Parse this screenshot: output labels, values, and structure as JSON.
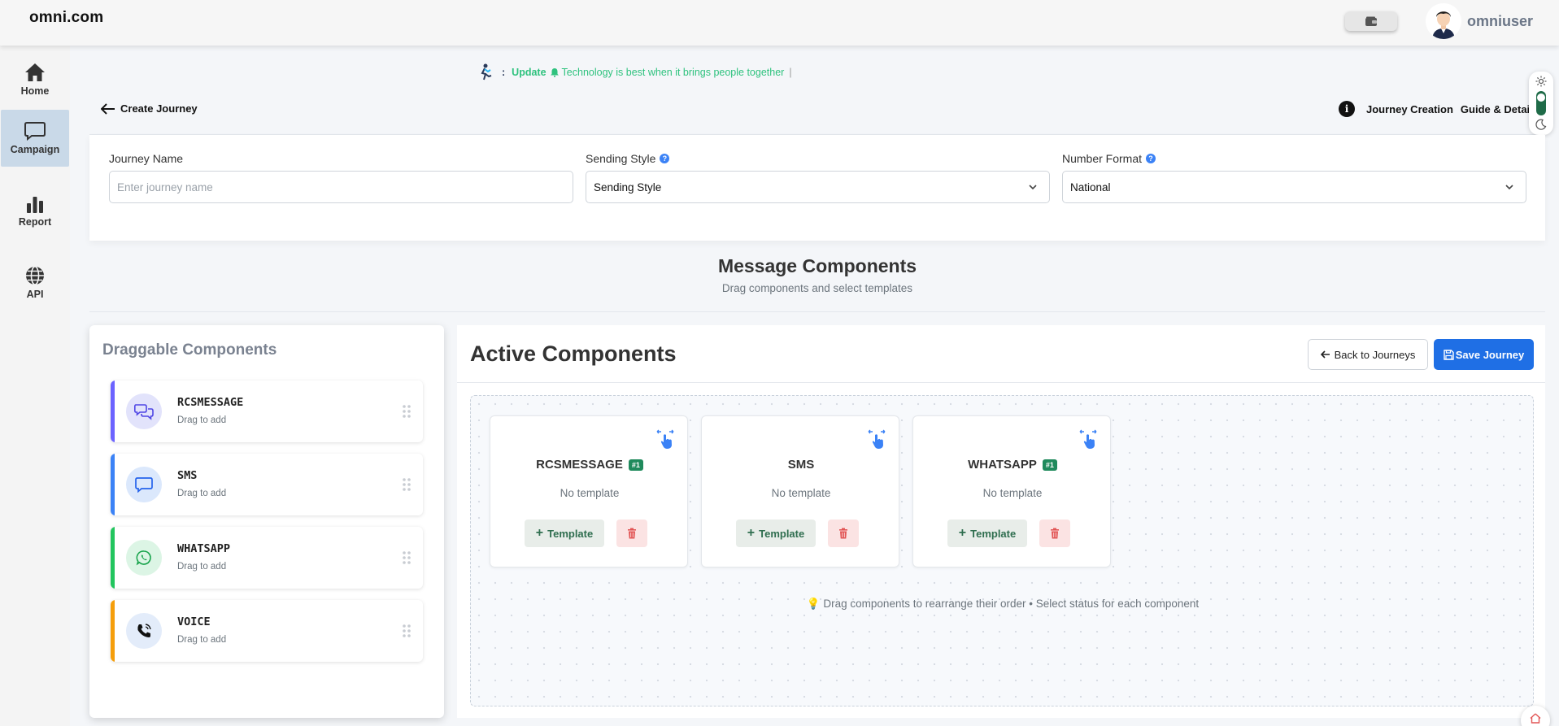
{
  "header": {
    "brand": "omni.com",
    "username": "omniuser"
  },
  "sidebar": {
    "items": [
      {
        "label": "Home",
        "icon": "home-icon"
      },
      {
        "label": "Campaign",
        "icon": "chat-icon",
        "active": true
      },
      {
        "label": "Report",
        "icon": "bar-chart-icon"
      },
      {
        "label": "API",
        "icon": "globe-icon"
      }
    ]
  },
  "marquee": {
    "prefix": ":",
    "update_label": "Update",
    "text": "Technology is best when it brings people together",
    "cursor": "|"
  },
  "page": {
    "back_label": "Create Journey",
    "guide_label_1": "Journey Creation",
    "guide_label_2": "Guide & Details"
  },
  "form": {
    "journey_name_label": "Journey Name",
    "journey_name_placeholder": "Enter journey name",
    "sending_style_label": "Sending Style",
    "sending_style_value": "Sending Style",
    "number_format_label": "Number Format",
    "number_format_value": "National"
  },
  "message_components": {
    "title": "Message Components",
    "subtitle": "Drag components and select templates"
  },
  "draggable": {
    "title": "Draggable Components",
    "items": [
      {
        "name": "RCSMESSAGE",
        "sub": "Drag to add",
        "color": "#6c63ff"
      },
      {
        "name": "SMS",
        "sub": "Drag to add",
        "color": "#3b82f6"
      },
      {
        "name": "WHATSAPP",
        "sub": "Drag to add",
        "color": "#22c55e"
      },
      {
        "name": "VOICE",
        "sub": "Drag to add",
        "color": "#f59e0b"
      }
    ]
  },
  "active": {
    "title": "Active Components",
    "back_button": "Back to Journeys",
    "save_button": "Save Journey",
    "cards": [
      {
        "name": "RCSMESSAGE",
        "badge": "#1",
        "status": "No template",
        "template_button": "Template"
      },
      {
        "name": "SMS",
        "badge": "",
        "status": "No template",
        "template_button": "Template"
      },
      {
        "name": "WHATSAPP",
        "badge": "#1",
        "status": "No template",
        "template_button": "Template"
      }
    ],
    "hint": "💡 Drag components to rearrange their order • Select status for each component"
  },
  "colors": {
    "accent_blue": "#1f6fe5",
    "accent_green": "#2ec27e",
    "badge_green": "#1f8a5c",
    "danger": "#e25555"
  }
}
